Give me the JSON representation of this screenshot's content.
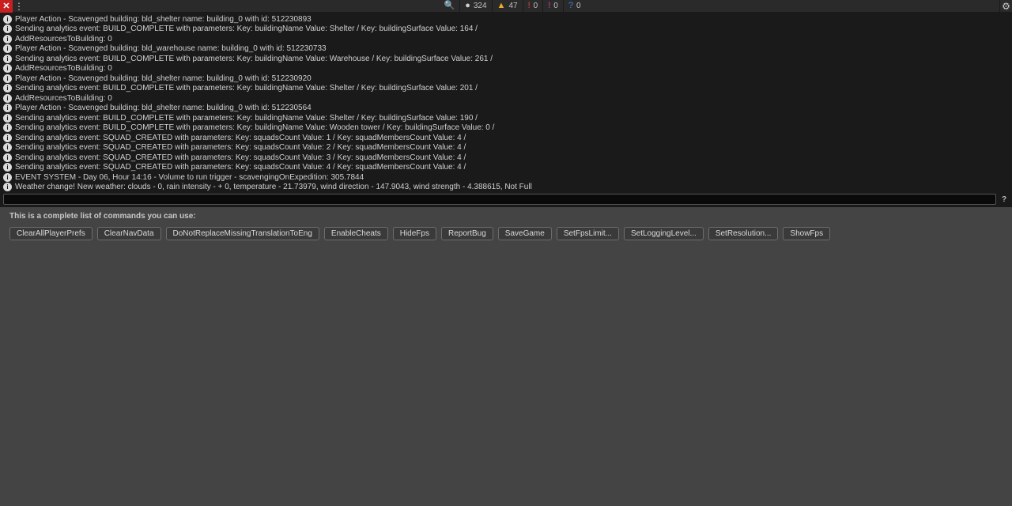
{
  "toolbar": {
    "stats": [
      {
        "name": "search-icon",
        "glyph": "🔍",
        "color": "#c0c0c0",
        "count": ""
      },
      {
        "name": "info-icon",
        "glyph": "●",
        "color": "#d0d0d0",
        "count": "324"
      },
      {
        "name": "warn-icon",
        "glyph": "▲",
        "color": "#e4b020",
        "count": "47"
      },
      {
        "name": "error-icon",
        "glyph": "!",
        "color": "#e04040",
        "count": "0"
      },
      {
        "name": "assert-icon",
        "glyph": "!",
        "color": "#d040a0",
        "count": "0"
      },
      {
        "name": "help-icon",
        "glyph": "?",
        "color": "#4080d0",
        "count": "0"
      }
    ]
  },
  "log": [
    "Player Action - Scavenged building: bld_shelter name: building_0 with id: 512230893",
    "Sending analytics event: BUILD_COMPLETE with parameters: Key: buildingName Value: Shelter / Key: buildingSurface Value: 164 /",
    "AddResourcesToBuilding: 0",
    "Player Action - Scavenged building: bld_warehouse name: building_0 with id: 512230733",
    "Sending analytics event: BUILD_COMPLETE with parameters: Key: buildingName Value: Warehouse / Key: buildingSurface Value: 261 /",
    "AddResourcesToBuilding: 0",
    "Player Action - Scavenged building: bld_shelter name: building_0 with id: 512230920",
    "Sending analytics event: BUILD_COMPLETE with parameters: Key: buildingName Value: Shelter / Key: buildingSurface Value: 201 /",
    "AddResourcesToBuilding: 0",
    "Player Action - Scavenged building: bld_shelter name: building_0 with id: 512230564",
    "Sending analytics event: BUILD_COMPLETE with parameters: Key: buildingName Value: Shelter / Key: buildingSurface Value: 190 /",
    "Sending analytics event: BUILD_COMPLETE with parameters: Key: buildingName Value: Wooden tower / Key: buildingSurface Value: 0 /",
    "Sending analytics event: SQUAD_CREATED with parameters: Key: squadsCount Value: 1 / Key: squadMembersCount Value: 4 /",
    "Sending analytics event: SQUAD_CREATED with parameters: Key: squadsCount Value: 2 / Key: squadMembersCount Value: 4 /",
    "Sending analytics event: SQUAD_CREATED with parameters: Key: squadsCount Value: 3 / Key: squadMembersCount Value: 4 /",
    "Sending analytics event: SQUAD_CREATED with parameters: Key: squadsCount Value: 4 / Key: squadMembersCount Value: 4 /",
    "EVENT SYSTEM - Day 06, Hour 14:16 - Volume to run trigger - scavengingOnExpedition: 305.7844",
    "Weather change! New weather: clouds - 0, rain intensity -  + 0, temperature - 21.73979, wind direction - 147.9043, wind strength - 4.388615, Not Full"
  ],
  "console": {
    "input_value": "",
    "placeholder": ""
  },
  "commands": {
    "title": "This is a complete list of commands you can use:",
    "list": [
      "ClearAllPlayerPrefs",
      "ClearNavData",
      "DoNotReplaceMissingTranslationToEng",
      "EnableCheats",
      "HideFps",
      "ReportBug",
      "SaveGame",
      "SetFpsLimit...",
      "SetLoggingLevel...",
      "SetResolution...",
      "ShowFps"
    ]
  }
}
